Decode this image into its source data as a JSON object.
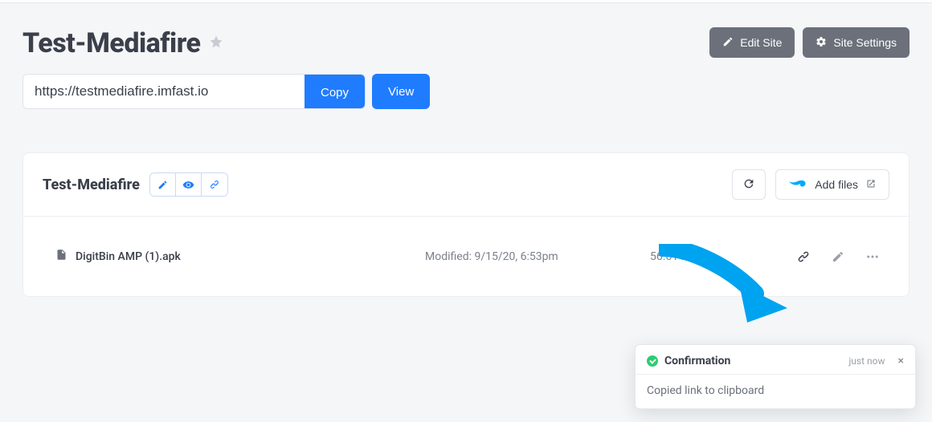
{
  "header": {
    "title": "Test-Mediafire",
    "edit_site_label": "Edit Site",
    "site_settings_label": "Site Settings"
  },
  "url_bar": {
    "value": "https://testmediafire.imfast.io",
    "copy_label": "Copy",
    "view_label": "View"
  },
  "card": {
    "title": "Test-Mediafire",
    "add_files_label": "Add files"
  },
  "file": {
    "name": "DigitBin AMP (1).apk",
    "modified_label": "Modified: 9/15/20, 6:53pm",
    "size": "56.61 KB"
  },
  "toast": {
    "title": "Confirmation",
    "time": "just now",
    "body": "Copied link to clipboard"
  }
}
